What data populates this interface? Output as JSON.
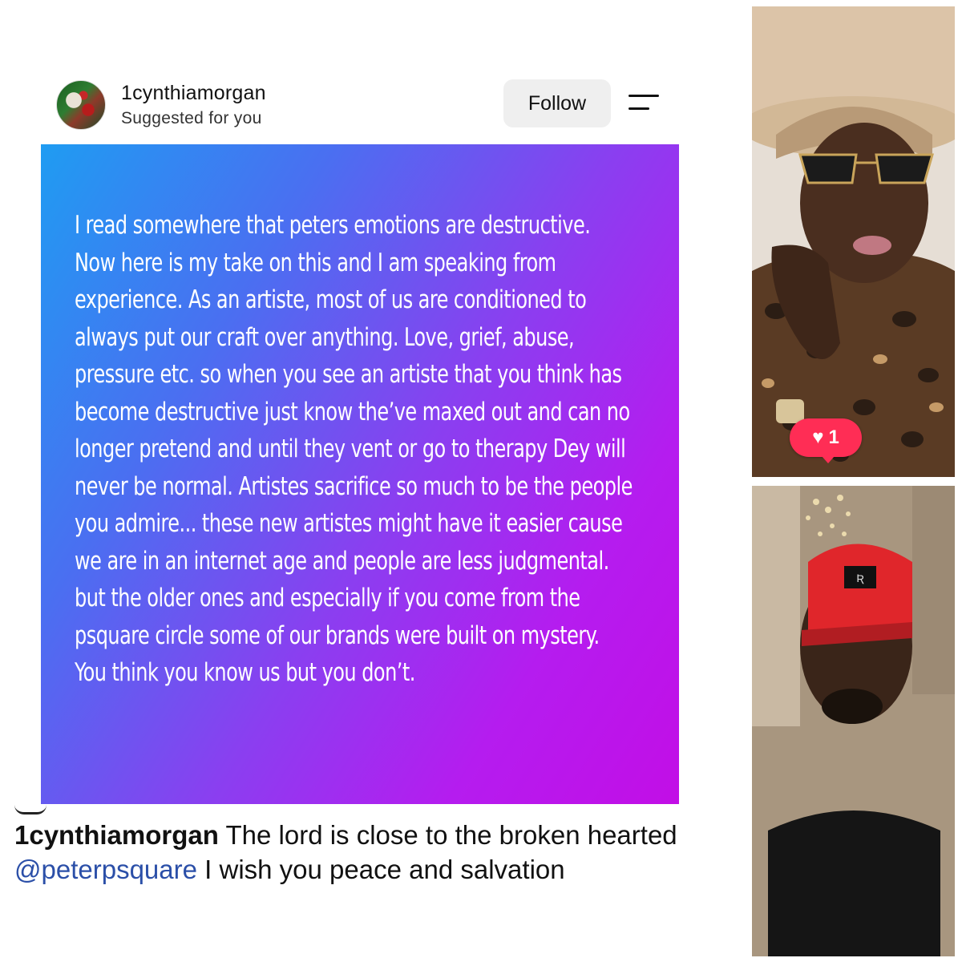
{
  "post": {
    "username": "1cynthiamorgan",
    "subtitle": "Suggested for you",
    "follow_label": "Follow",
    "image_text": "I read somewhere that peters emotions are destructive. Now here is my take on this and I am speaking from experience. As an artiste, most of us are conditioned to always put our craft over anything. Love, grief, abuse, pressure etc. so when you see an artiste that you think has become destructive just know the’ve maxed out and can no longer pretend and until they vent or go to therapy Dey will never be normal. Artistes sacrifice so much to be the people you admire... these new artistes might have it easier cause we are in an internet age and people are less judgmental. but the older ones and especially if you come from the psquare circle some of our brands were built on mystery. You think you know us but you don’t."
  },
  "caption": {
    "username": "1cynthiamorgan",
    "text_before_mention": "The lord is close to the broken hearted",
    "mention": "@peterpsquare",
    "text_after_mention": "I wish you peace and salvation"
  },
  "like_badge": {
    "icon": "heart-icon",
    "count": "1"
  },
  "colors": {
    "gradient_start": "#1f9cf2",
    "gradient_end": "#c20ee6",
    "mention": "#2b4fa8",
    "like_badge": "#ff2d55"
  }
}
